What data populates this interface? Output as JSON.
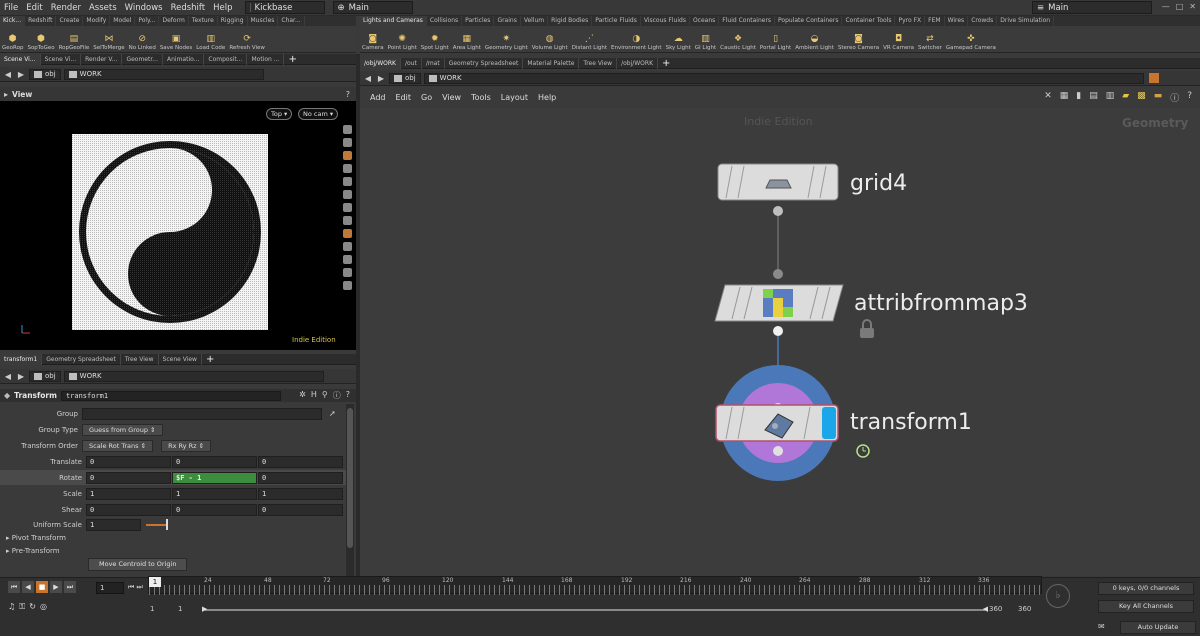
{
  "menubar": {
    "items": [
      "File",
      "Edit",
      "Render",
      "Assets",
      "Windows",
      "Redshift",
      "Help"
    ],
    "desktop": "Kickbase",
    "context": "Main",
    "right_context": "Main"
  },
  "shelf_left": {
    "tabs": [
      "Kick...",
      "Redshift",
      "Create",
      "Modify",
      "Model",
      "Poly...",
      "Deform",
      "Texture",
      "Rigging",
      "Muscles",
      "Char..."
    ],
    "tools": [
      "GeoRop",
      "SopToGeo",
      "RopGeoFile",
      "SelToMerge",
      "No Linked",
      "Save Nodes",
      "Load Code",
      "Refresh View"
    ]
  },
  "shelf_right": {
    "tabs": [
      "Lights and Cameras",
      "Collisions",
      "Particles",
      "Grains",
      "Vellum",
      "Rigid Bodies",
      "Particle Fluids",
      "Viscous Fluids",
      "Oceans",
      "Fluid Containers",
      "Populate Containers",
      "Container Tools",
      "Pyro FX",
      "FEM",
      "Wires",
      "Crowds",
      "Drive Simulation"
    ],
    "tools": [
      "Camera",
      "Point Light",
      "Spot Light",
      "Area Light",
      "Geometry Light",
      "Volume Light",
      "Distant Light",
      "Environment Light",
      "Sky Light",
      "GI Light",
      "Caustic Light",
      "Portal Light",
      "Ambient Light",
      "Stereo Camera",
      "VR Camera",
      "Switcher",
      "Gamepad Camera"
    ]
  },
  "top_left_tabs": [
    "Scene Vi...",
    "Scene Vi...",
    "Render V...",
    "Geometr...",
    "Animatio...",
    "Composit...",
    "Motion ..."
  ],
  "top_right_tabs": [
    "/obj/WORK",
    "/out",
    "/mat",
    "Geometry Spreadsheet",
    "Material Palette",
    "Tree View",
    "/obj/WORK"
  ],
  "path": {
    "root": "obj",
    "node": "WORK"
  },
  "viewport": {
    "label": "View",
    "view_button": "Top",
    "camera_button": "No cam",
    "watermark": "Indie Edition"
  },
  "bottom_left_tabs": [
    "transform1",
    "Geometry Spreadsheet",
    "Tree View",
    "Scene View"
  ],
  "params": {
    "node_type": "Transform",
    "node_name": "transform1",
    "group_label": "Group",
    "group_value": "",
    "group_type_label": "Group Type",
    "group_type_value": "Guess from Group",
    "order_label": "Transform Order",
    "order_value": "Scale Rot Trans",
    "rot_order_value": "Rx Ry Rz",
    "translate_label": "Translate",
    "translate": [
      "0",
      "0",
      "0"
    ],
    "rotate_label": "Rotate",
    "rotate": [
      "0",
      "$F - 1",
      "0"
    ],
    "scale_label": "Scale",
    "scale": [
      "1",
      "1",
      "1"
    ],
    "shear_label": "Shear",
    "shear": [
      "0",
      "0",
      "0"
    ],
    "uniform_label": "Uniform Scale",
    "uniform_value": "1",
    "pivot_folder": "Pivot Transform",
    "pre_folder": "Pre-Transform",
    "centroid_button": "Move Centroid to Origin"
  },
  "network": {
    "menu": [
      "Add",
      "Edit",
      "Go",
      "View",
      "Tools",
      "Layout",
      "Help"
    ],
    "watermark": "Indie Edition",
    "context_label": "Geometry",
    "nodes": [
      "grid4",
      "attribfrommap3",
      "transform1"
    ]
  },
  "timeline": {
    "current_frame": "1",
    "marker": "1",
    "ticks": [
      "24",
      "48",
      "72",
      "96",
      "120",
      "144",
      "168",
      "192",
      "216",
      "240",
      "264",
      "288",
      "312",
      "336"
    ],
    "range_start": "1",
    "range_start2": "1",
    "range_end": "360",
    "range_end2": "360",
    "keys_status": "0 keys, 0/0 channels",
    "key_all": "Key All Channels",
    "auto_update": "Auto Update"
  },
  "colors": {
    "accent_orange": "#c8732e",
    "expr_green": "#3d8d3f",
    "display_blue": "#4a78b8",
    "template_purple": "#b076d8",
    "flag_cyan": "#1aa6e8"
  }
}
